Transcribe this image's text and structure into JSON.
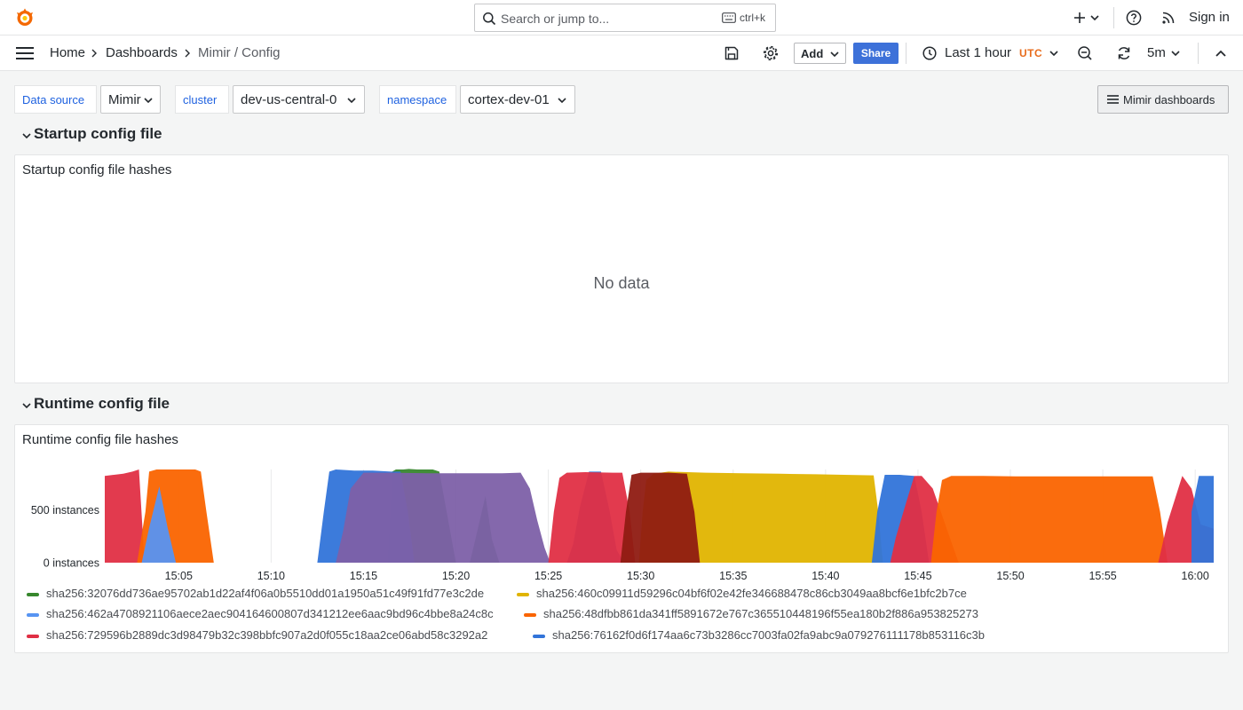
{
  "topbar": {
    "search_placeholder": "Search or jump to...",
    "search_shortcut": "ctrl+k",
    "signin_label": "Sign in"
  },
  "breadcrumbs": [
    "Home",
    "Dashboards",
    "Mimir / Config"
  ],
  "toolbar": {
    "add_label": "Add",
    "share_label": "Share",
    "time_range": "Last 1 hour",
    "timezone": "UTC",
    "refresh_interval": "5m"
  },
  "variables": [
    {
      "label": "Data source",
      "value": "Mimir"
    },
    {
      "label": "cluster",
      "value": "dev-us-central-0"
    },
    {
      "label": "namespace",
      "value": "cortex-dev-01"
    }
  ],
  "dashboard_links_label": "Mimir dashboards",
  "rows": [
    {
      "title": "Startup config file",
      "panel_title": "Startup config file hashes",
      "empty_text": "No data"
    },
    {
      "title": "Runtime config file",
      "panel_title": "Runtime config file hashes"
    }
  ],
  "chart_data": {
    "type": "area",
    "stacked": false,
    "x": [
      "15:05",
      "15:10",
      "15:15",
      "15:20",
      "15:25",
      "15:30",
      "15:35",
      "15:40",
      "15:45",
      "15:50",
      "15:55",
      "16:00"
    ],
    "y_ticks": [
      "0 instances",
      "500 instances"
    ],
    "ylim": [
      0,
      880
    ],
    "x_range": [
      "15:01",
      "16:01"
    ],
    "grid": true,
    "legend_position": "bottom",
    "series": [
      {
        "name": "sha256:32076dd736ae95702ab1d22af4f06a0b5510dd01a1950a51c49f91fd77e3c2de",
        "color": "#37872d",
        "segments": [
          {
            "t": [
              15.3,
              15.45,
              15.55,
              15.75,
              16.15,
              16.45,
              16.9,
              17.3,
              17.75,
              18.1,
              18.5,
              19.0,
              19.75
            ],
            "v": [
              0,
              480,
              860,
              880,
              880,
              885,
              880,
              880,
              880,
              860,
              480,
              0,
              0
            ]
          },
          {
            "t": [
              19.75,
              20.05,
              20.6,
              20.95,
              21.35
            ],
            "v": [
              0,
              220,
              630,
              220,
              0
            ]
          }
        ]
      },
      {
        "name": "sha256:460c09911d59296c04bf6f02e42fe346688478c86cb3049aa8bcf6e1bfc2b7ce",
        "color": "#e0b400",
        "segments": [
          {
            "t": [
              26.2,
              26.5,
              26.75,
              27.1,
              27.5
            ],
            "v": [
              0,
              480,
              860,
              480,
              0
            ]
          },
          {
            "t": [
              28.9,
              29.1,
              29.3,
              29.7,
              30.5,
              32.5,
              34.5,
              36.5,
              38.5,
              40.0,
              41.6,
              41.85,
              42.1,
              42.5
            ],
            "v": [
              0,
              480,
              780,
              840,
              860,
              850,
              845,
              840,
              835,
              830,
              825,
              480,
              0,
              0
            ]
          }
        ]
      },
      {
        "name": "sha256:462a4708921106aece2aec904164600807d341212ee6aac9bd96c4bbe8a24c8c",
        "color": "#5794f2",
        "segments": [
          {
            "t": [
              2.0,
              2.4,
              2.95,
              3.4,
              3.85
            ],
            "v": [
              0,
              330,
              720,
              330,
              0
            ]
          }
        ]
      },
      {
        "name": "sha256:48dfbb861da341ff5891672e767c365510448196f55ea180b2f886a953825273",
        "color": "#fa6400",
        "segments": [
          {
            "t": [
              1.75,
              2.2,
              2.4,
              2.8,
              3.6,
              4.4,
              4.9,
              5.2,
              5.5,
              5.9,
              6.5
            ],
            "v": [
              0,
              480,
              860,
              880,
              880,
              880,
              880,
              860,
              480,
              0,
              0
            ]
          },
          {
            "t": [
              44.7,
              45.0,
              45.3,
              45.8,
              47.5,
              49.5,
              51.5,
              53.5,
              55.5,
              56.7,
              57.1,
              57.5,
              58.0
            ],
            "v": [
              0,
              480,
              780,
              820,
              820,
              815,
              815,
              815,
              815,
              815,
              480,
              0,
              0
            ]
          }
        ]
      },
      {
        "name": "sha256:729596b2889dc3d98479b32c398bbfc907a2d0f055c18aa2ce06abd58c3292a2",
        "color": "#e02f44",
        "segments": [
          {
            "t": [
              0.0,
              0.5,
              1.0,
              1.5,
              1.85,
              2.15
            ],
            "v": [
              820,
              830,
              840,
              860,
              880,
              0
            ]
          },
          {
            "t": [
              24.0,
              24.3,
              24.6,
              25.0,
              26.0,
              27.5,
              28.0,
              28.4,
              28.7
            ],
            "v": [
              0,
              480,
              800,
              850,
              855,
              850,
              850,
              480,
              0
            ]
          },
          {
            "t": [
              42.5,
              42.8,
              43.4,
              43.8,
              44.2,
              44.8,
              45.6,
              46.2,
              46.8
            ],
            "v": [
              0,
              240,
              590,
              820,
              820,
              700,
              300,
              0,
              0
            ]
          },
          {
            "t": [
              57.0,
              57.5,
              58.3,
              58.8,
              59.3,
              60.0
            ],
            "v": [
              0,
              380,
              820,
              700,
              360,
              320
            ]
          }
        ]
      },
      {
        "name": "sha256:76162f0d6f174aa6c73b3286cc7003fa02fa9abc9a079276111178b853116c3b",
        "color": "#3274d9",
        "segments": [
          {
            "t": [
              11.5,
              11.85,
              12.15,
              12.5,
              13.5,
              14.5,
              15.5,
              16.0,
              16.4,
              16.75,
              17.1
            ],
            "v": [
              0,
              480,
              860,
              880,
              870,
              870,
              860,
              860,
              480,
              0,
              0
            ]
          },
          {
            "t": [
              25.0,
              25.35,
              25.7,
              26.2,
              26.85,
              27.3,
              27.7,
              28.1
            ],
            "v": [
              0,
              180,
              520,
              860,
              860,
              500,
              120,
              0
            ]
          },
          {
            "t": [
              41.5,
              41.8,
              42.2,
              42.6,
              43.0,
              43.4,
              43.8,
              44.2,
              44.6
            ],
            "v": [
              0,
              480,
              830,
              830,
              830,
              825,
              820,
              480,
              0
            ]
          },
          {
            "t": [
              58.8,
              59.2,
              59.6,
              60.0
            ],
            "v": [
              480,
              820,
              820,
              820
            ]
          }
        ]
      }
    ]
  }
}
